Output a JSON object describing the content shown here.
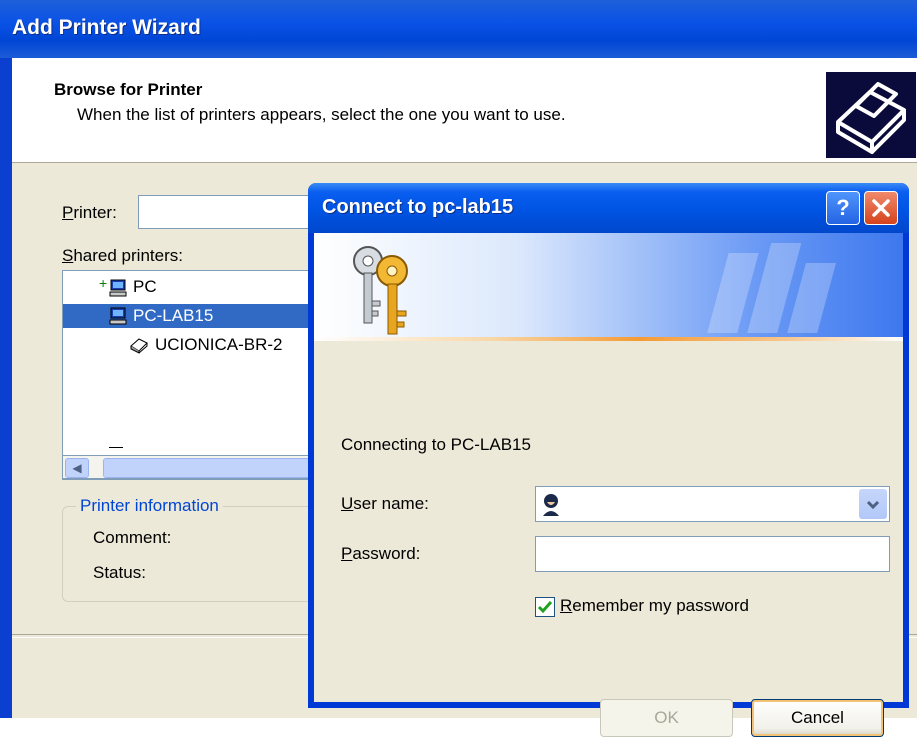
{
  "wizard": {
    "title": "Add Printer Wizard",
    "header_title": "Browse for Printer",
    "header_subtitle": "When the list of printers appears, select the one you want to use.",
    "printer_label_u": "P",
    "printer_label_rest": "rinter:",
    "shared_label_u": "S",
    "shared_label_rest": "hared printers:",
    "tree": [
      {
        "label": "PC",
        "selected": false,
        "icon": "computer-icon"
      },
      {
        "label": "PC-LAB15",
        "selected": true,
        "icon": "computer-icon"
      },
      {
        "label": "UCIONICA-BR-2",
        "selected": false,
        "icon": "printer-icon"
      }
    ],
    "info_group_title": "Printer information",
    "comment_label": "Comment:",
    "status_label": "Status:"
  },
  "dialog": {
    "title": "Connect to pc-lab15",
    "help_glyph": "?",
    "connecting_text": "Connecting to PC-LAB15",
    "user_label_u": "U",
    "user_label_rest": "ser name:",
    "password_label_u": "P",
    "password_label_rest": "assword:",
    "remember_u": "R",
    "remember_rest": "emember my password",
    "remember_checked": true,
    "ok_label": "OK",
    "cancel_label": "Cancel"
  },
  "colors": {
    "titlebar": "#0054e3",
    "selection": "#316ac5",
    "group_title": "#0046d5"
  }
}
